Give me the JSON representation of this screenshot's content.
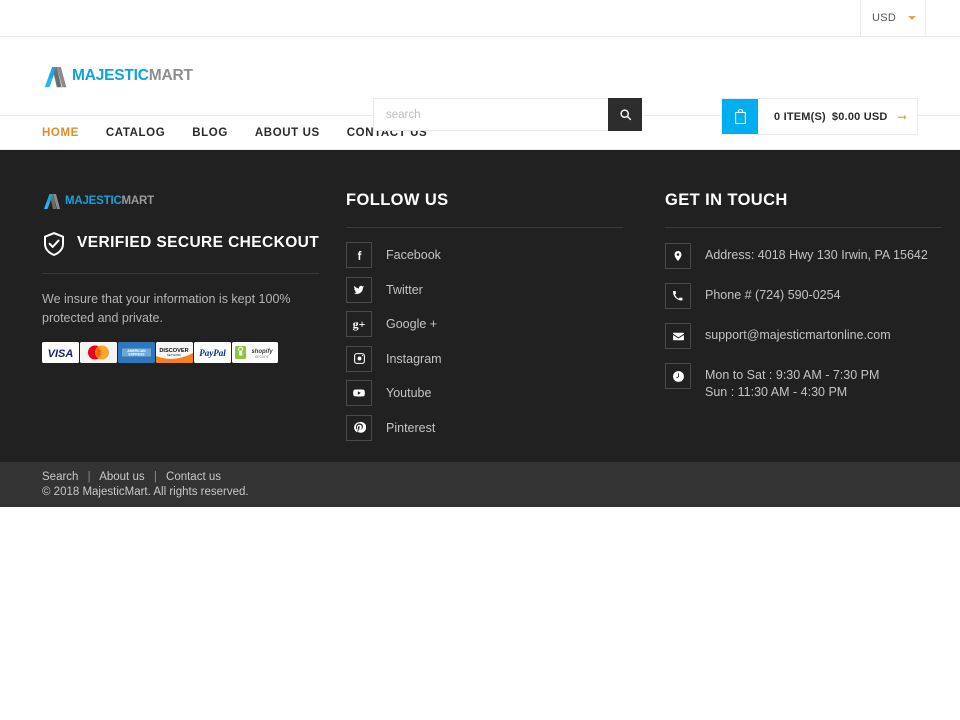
{
  "topbar": {
    "currency": {
      "label": "USD",
      "icon": "chevron-down-icon"
    }
  },
  "header": {
    "logo": {
      "part1": "MAJESTIC",
      "part2": "MART",
      "icon": "majesticmart-logo-icon"
    },
    "search": {
      "placeholder": "search",
      "value": "",
      "button_icon": "search-icon"
    },
    "cart": {
      "icon": "shopping-bag-icon",
      "items": "0 ITEM(S)",
      "total": "$0.00 USD",
      "arrow": "arrow-right-icon"
    }
  },
  "nav": {
    "items": [
      {
        "label": "HOME",
        "active": true
      },
      {
        "label": "CATALOG",
        "active": false
      },
      {
        "label": "BLOG",
        "active": false
      },
      {
        "label": "ABOUT US",
        "active": false
      },
      {
        "label": "CONTACT US",
        "active": false
      }
    ]
  },
  "footer": {
    "left": {
      "logo": {
        "part1": "MAJESTIC",
        "part2": "MART",
        "icon": "majesticmart-logo-icon"
      },
      "verified_icon": "shield-check-icon",
      "verified_title": "VERIFIED SECURE CHECKOUT",
      "insure_text": "We insure that your information is kept 100% protected and private.",
      "payments": [
        {
          "name": "visa",
          "label": "VISA"
        },
        {
          "name": "mastercard",
          "label": "MasterCard"
        },
        {
          "name": "american-express",
          "label": "AMERICAN EXPRESS"
        },
        {
          "name": "discover",
          "label": "DISCOVER"
        },
        {
          "name": "paypal",
          "label": "PayPal"
        },
        {
          "name": "shopify-secure",
          "label": "shopify SECURE"
        }
      ]
    },
    "follow": {
      "title": "FOLLOW US",
      "items": [
        {
          "label": "Facebook",
          "icon": "facebook-icon"
        },
        {
          "label": "Twitter",
          "icon": "twitter-icon"
        },
        {
          "label": "Google +",
          "icon": "google-plus-icon"
        },
        {
          "label": "Instagram",
          "icon": "instagram-icon"
        },
        {
          "label": "Youtube",
          "icon": "youtube-icon"
        },
        {
          "label": "Pinterest",
          "icon": "pinterest-icon"
        }
      ]
    },
    "touch": {
      "title": "GET IN TOUCH",
      "items": [
        {
          "icon": "map-pin-icon",
          "line1": "Address: 4018 Hwy 130 Irwin, PA 15642",
          "line2": ""
        },
        {
          "icon": "phone-icon",
          "line1": "Phone # (724) 590-0254",
          "line2": ""
        },
        {
          "icon": "envelope-icon",
          "line1": "support@majesticmartonline.com",
          "line2": ""
        },
        {
          "icon": "clock-icon",
          "line1": "Mon to Sat : 9:30 AM - 7:30 PM",
          "line2": "Sun : 11:30 AM - 4:30 PM"
        }
      ]
    }
  },
  "bottombar": {
    "links": [
      {
        "label": "Search"
      },
      {
        "label": "About us"
      },
      {
        "label": "Contact us"
      }
    ],
    "separator": "|",
    "copyright": "© 2018 MajesticMart. All rights reserved."
  },
  "colors": {
    "accent_orange": "#e08c2c",
    "cart_blue": "#00aeef",
    "logo_blue": "#0fa3dd",
    "footer_bg": "#212121",
    "bottombar_bg": "#333333"
  }
}
